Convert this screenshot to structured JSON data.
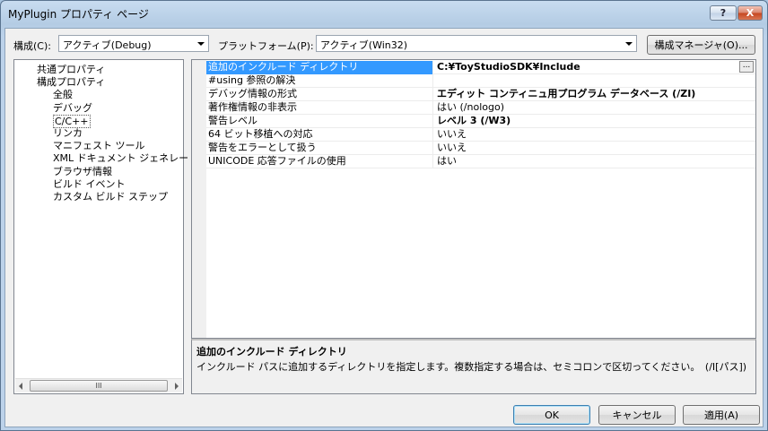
{
  "window": {
    "title": "MyPlugin プロパティ ページ",
    "help_label": "?",
    "close_label": "X"
  },
  "toolbar": {
    "config_label": "構成(C):",
    "config_value": "アクティブ(Debug)",
    "platform_label": "プラットフォーム(P):",
    "platform_value": "アクティブ(Win32)",
    "config_manager_label": "構成マネージャ(O)..."
  },
  "tree": {
    "items": [
      {
        "label": "共通プロパティ",
        "level": 1
      },
      {
        "label": "構成プロパティ",
        "level": 1
      },
      {
        "label": "全般",
        "level": 2
      },
      {
        "label": "デバッグ",
        "level": 2
      },
      {
        "label": "C/C++",
        "level": 2,
        "selected": true
      },
      {
        "label": "リンカ",
        "level": 2
      },
      {
        "label": "マニフェスト ツール",
        "level": 2
      },
      {
        "label": "XML ドキュメント ジェネレー",
        "level": 2
      },
      {
        "label": "ブラウザ情報",
        "level": 2
      },
      {
        "label": "ビルド イベント",
        "level": 2
      },
      {
        "label": "カスタム ビルド ステップ",
        "level": 2
      }
    ],
    "scroll_thumb": "III"
  },
  "properties": {
    "rows": [
      {
        "name": "追加のインクルード ディレクトリ",
        "value": "C:¥ToyStudioSDK¥Include",
        "bold": true,
        "selected": true,
        "ellipsis": "..."
      },
      {
        "name": "#using 参照の解決",
        "value": "",
        "bold": false
      },
      {
        "name": "デバッグ情報の形式",
        "value": "エディット コンティニュ用プログラム データベース (/ZI)",
        "bold": true
      },
      {
        "name": "著作権情報の非表示",
        "value": "はい (/nologo)",
        "bold": false
      },
      {
        "name": "警告レベル",
        "value": "レベル 3 (/W3)",
        "bold": true
      },
      {
        "name": "64 ビット移植への対応",
        "value": "いいえ",
        "bold": false
      },
      {
        "name": "警告をエラーとして扱う",
        "value": "いいえ",
        "bold": false
      },
      {
        "name": "UNICODE 応答ファイルの使用",
        "value": "はい",
        "bold": false
      }
    ]
  },
  "description": {
    "title": "追加のインクルード ディレクトリ",
    "text": "インクルード パスに追加するディレクトリを指定します。複数指定する場合は、セミコロンで区切ってください。　(/I[パス])"
  },
  "buttons": {
    "ok": "OK",
    "cancel": "キャンセル",
    "apply": "適用(A)"
  }
}
